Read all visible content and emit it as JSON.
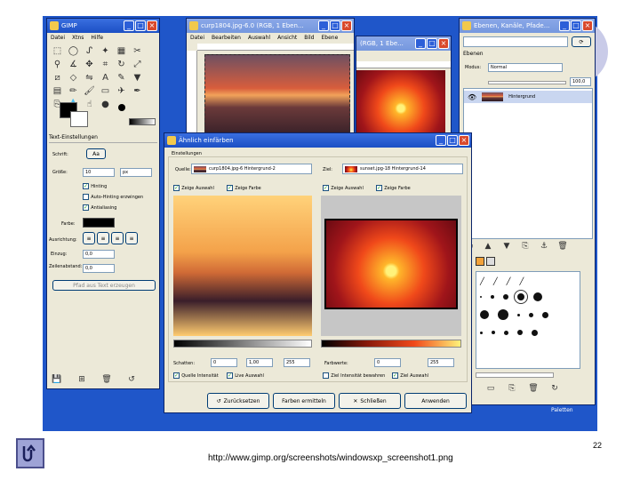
{
  "gimp_toolbox": {
    "title": "GIMP",
    "menu": [
      "Datei",
      "Xtns",
      "Hilfe"
    ],
    "tool_options_title": "Text-Einstellungen",
    "font_label": "Schrift:",
    "font_value": "Aa",
    "size_label": "Größe:",
    "size_value": "10",
    "size_unit": "px",
    "hinting": "Hinting",
    "autohinting": "Auto-Hinting erzwingen",
    "antialiasing": "Antialiasing",
    "color_label": "Farbe:",
    "justify_label": "Ausrichtung:",
    "indent_label": "Einzug:",
    "indent_value": "0,0",
    "linespacing_label": "Zeilenabstand:",
    "linespacing_value": "0,0",
    "path_button": "Pfad aus Text erzeugen"
  },
  "image_window": {
    "title": "curp1804.jpg-6.0 (RGB, 1 Eben...",
    "menu": [
      "Datei",
      "Bearbeiten",
      "Auswahl",
      "Ansicht",
      "Bild",
      "Ebene"
    ]
  },
  "image_window_2": {
    "title": "(RGB, 1 Ebe..."
  },
  "layers_window": {
    "title": "Ebenen, Kanäle, Pfade...",
    "tab": "Ebenen",
    "mode_label": "Modus:",
    "mode_value": "Normal",
    "opacity_value": "100,0",
    "layer_name": "Hintergrund"
  },
  "dialog": {
    "title": "Ähnlich einfärben",
    "group_label": "Einstellungen",
    "left": {
      "source_label": "Quelle:",
      "source_value": "curp1804.jpg-6 Hintergrund-2",
      "show_selection": "Zeige Auswahl",
      "show_color": "Zeige Farbe",
      "shadows_label": "Schatten:",
      "shadows_value": "0",
      "gamma_value": "1,00",
      "highlights_value": "255",
      "in_intensity": "Quelle Intensität",
      "in_selection": "Live Auswahl"
    },
    "right": {
      "dest_label": "Ziel:",
      "dest_value": "sunset.jpg-18 Hintergrund-14",
      "show_selection": "Zeige Auswahl",
      "show_color": "Zeige Farbe",
      "shadows_label": "Farbwerte:",
      "shadows_value": "0",
      "highlights_value": "255",
      "in_intensity": "Ziel Intensität bewahren",
      "in_selection": "Ziel Auswahl"
    },
    "buttons": {
      "reset": "Zurücksetzen",
      "sample": "Farben ermitteln",
      "close": "Schließen",
      "apply": "Anwenden"
    }
  },
  "taskbar_text": "Paletten",
  "slide": {
    "url": "http://www.gimp.org/screenshots/windowsxp_screenshot1.png",
    "page_number": "22"
  },
  "colors": {
    "desktop": "#1f56c9",
    "titlebar": "#1b4fc4",
    "window_bg": "#ece9d8"
  }
}
